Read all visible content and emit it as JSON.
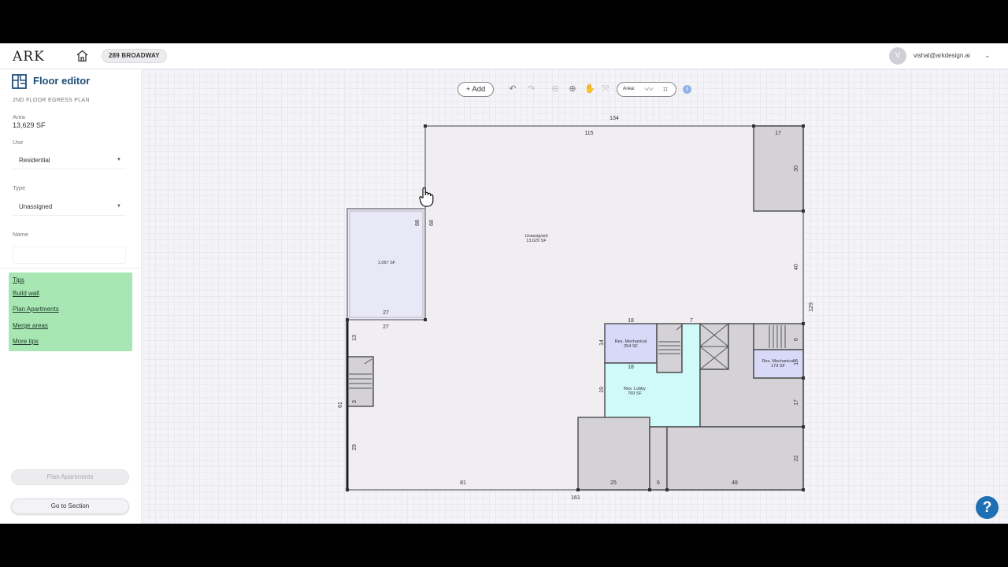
{
  "header": {
    "logo": "ARK",
    "project": "289 BROADWAY",
    "user_initial": "V",
    "user_email": "vishal@arkdesign.ai"
  },
  "sidebar": {
    "title": "Floor editor",
    "subtitle": "2ND FLOOR EGRESS PLAN",
    "area_label": "Area",
    "area_value": "13,629 SF",
    "use_label": "Use",
    "use_value": "Residential",
    "type_label": "Type",
    "type_value": "Unassigned",
    "name_label": "Name",
    "name_value": "",
    "tips": {
      "title": "Tips",
      "links": [
        "Build wall",
        "Plan Apartments",
        "Merge areas",
        "More tips"
      ]
    },
    "plan_button": "Plan Apartments",
    "section_button": "Go to Section"
  },
  "toolbar": {
    "add_label": "Add",
    "area_label": "Area:"
  },
  "plan": {
    "rooms": [
      {
        "name": "Unassigned",
        "area": "13,629 SF"
      },
      {
        "name": "",
        "area": "1,067 SF"
      },
      {
        "name": "Res. Mechanical",
        "area": "254 SF"
      },
      {
        "name": "Res. Lobby",
        "area": "769 SF"
      },
      {
        "name": "Res. Mechanical",
        "area": "179 SF"
      }
    ],
    "dimensions": {
      "top_total": "134",
      "top_inner": "115",
      "top_right": "17",
      "right_upper": "30",
      "right_mid": "40",
      "right_total": "129",
      "left_notch_a": "68",
      "left_notch_b": "68",
      "annex_bottom_a": "27",
      "annex_bottom_b": "27",
      "left_upper": "13",
      "left_total": "61",
      "left_lower": "29",
      "stair_small": "3",
      "mech_top": "18",
      "mech_bottom": "18",
      "mech_side": "14",
      "lobby_side": "19",
      "corridor_top": "7",
      "mech2_side_a": "6",
      "mech2_side_b": "18",
      "right_lower": "17",
      "right_bottom": "22",
      "bottom_left": "81",
      "bottom_total": "161",
      "bottom_a": "25",
      "bottom_b": "6",
      "bottom_c": "48"
    }
  },
  "colors": {
    "brand": "#1e4e79",
    "tips_bg": "#a8e6b4",
    "floor_fill": "#f1eef2",
    "mechanical_fill": "#d8d8f8",
    "lobby_fill": "#d0fafa",
    "core_fill": "#d4d2d6",
    "help_bg": "#1f6fb5"
  },
  "help": "?"
}
